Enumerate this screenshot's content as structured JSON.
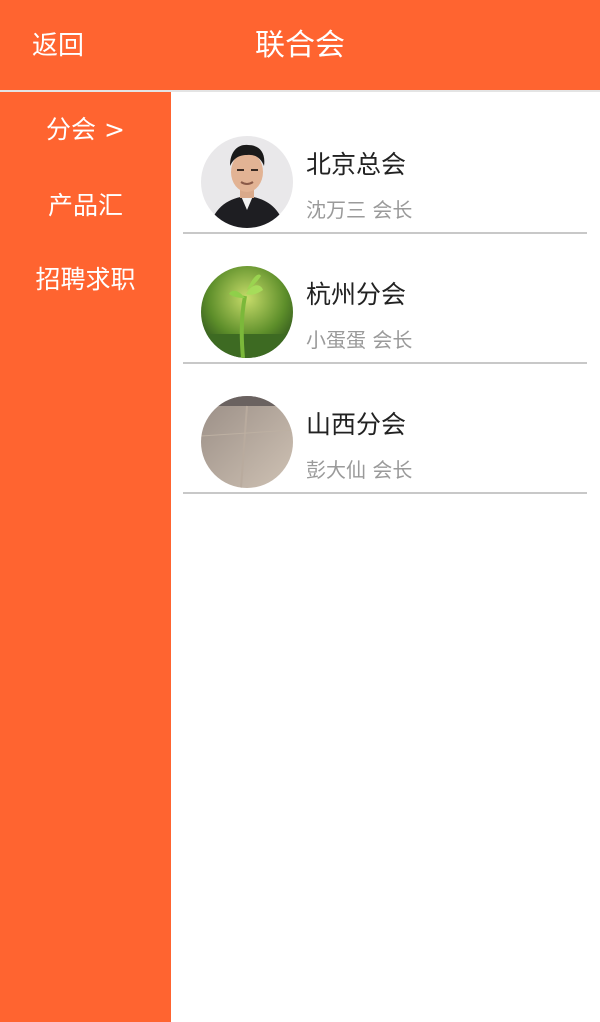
{
  "header": {
    "back_label": "返回",
    "title": "联合会"
  },
  "sidebar": {
    "items": [
      {
        "label": "分会 >",
        "active": true
      },
      {
        "label": "产品汇",
        "active": false
      },
      {
        "label": "招聘求职",
        "active": false
      }
    ]
  },
  "branches": [
    {
      "name": "北京总会",
      "leader": "沈万三 会长",
      "avatar_icon": "portrait-man-photo"
    },
    {
      "name": "杭州分会",
      "leader": "小蛋蛋 会长",
      "avatar_icon": "green-sprout-photo"
    },
    {
      "name": "山西分会",
      "leader": "彭大仙 会长",
      "avatar_icon": "beige-wall-photo"
    }
  ],
  "colors": {
    "brand": "#ff6430",
    "divider": "#c8c8c8",
    "subtext": "#9a9a9a"
  }
}
